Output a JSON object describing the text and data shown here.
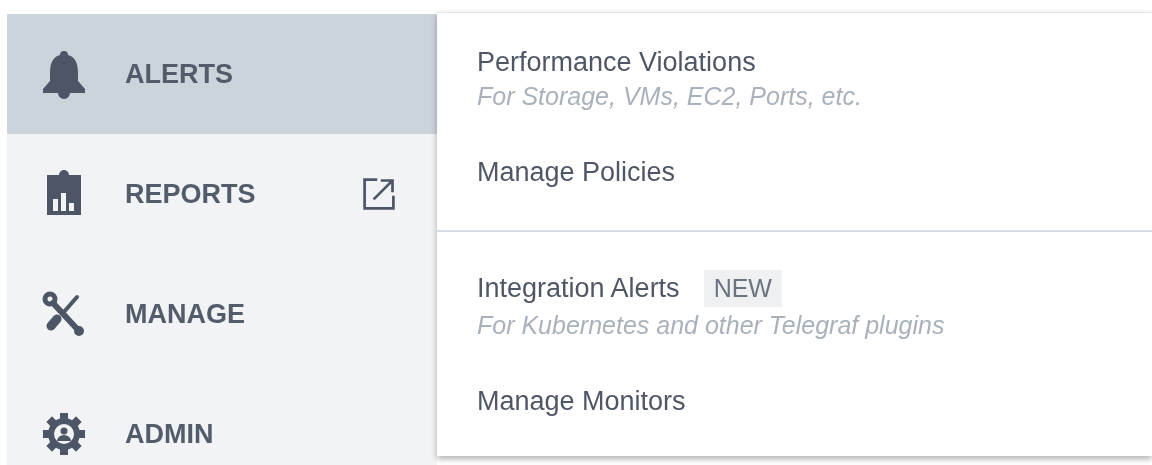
{
  "sidebar": {
    "items": [
      {
        "label": "ALERTS",
        "kind": "bell",
        "selected": true,
        "external": false
      },
      {
        "label": "REPORTS",
        "kind": "report",
        "selected": false,
        "external": true
      },
      {
        "label": "MANAGE",
        "kind": "tools",
        "selected": false,
        "external": false
      },
      {
        "label": "ADMIN",
        "kind": "admin",
        "selected": false,
        "external": false
      }
    ]
  },
  "menu": {
    "sections": [
      {
        "items": [
          {
            "title": "Performance Violations",
            "description": "For Storage, VMs, EC2, Ports, etc."
          },
          {
            "title": "Manage Policies"
          }
        ]
      },
      {
        "items": [
          {
            "title": "Integration Alerts",
            "badge": "NEW",
            "description": "For Kubernetes and other Telegraf plugins"
          },
          {
            "title": "Manage Monitors"
          }
        ]
      }
    ]
  }
}
